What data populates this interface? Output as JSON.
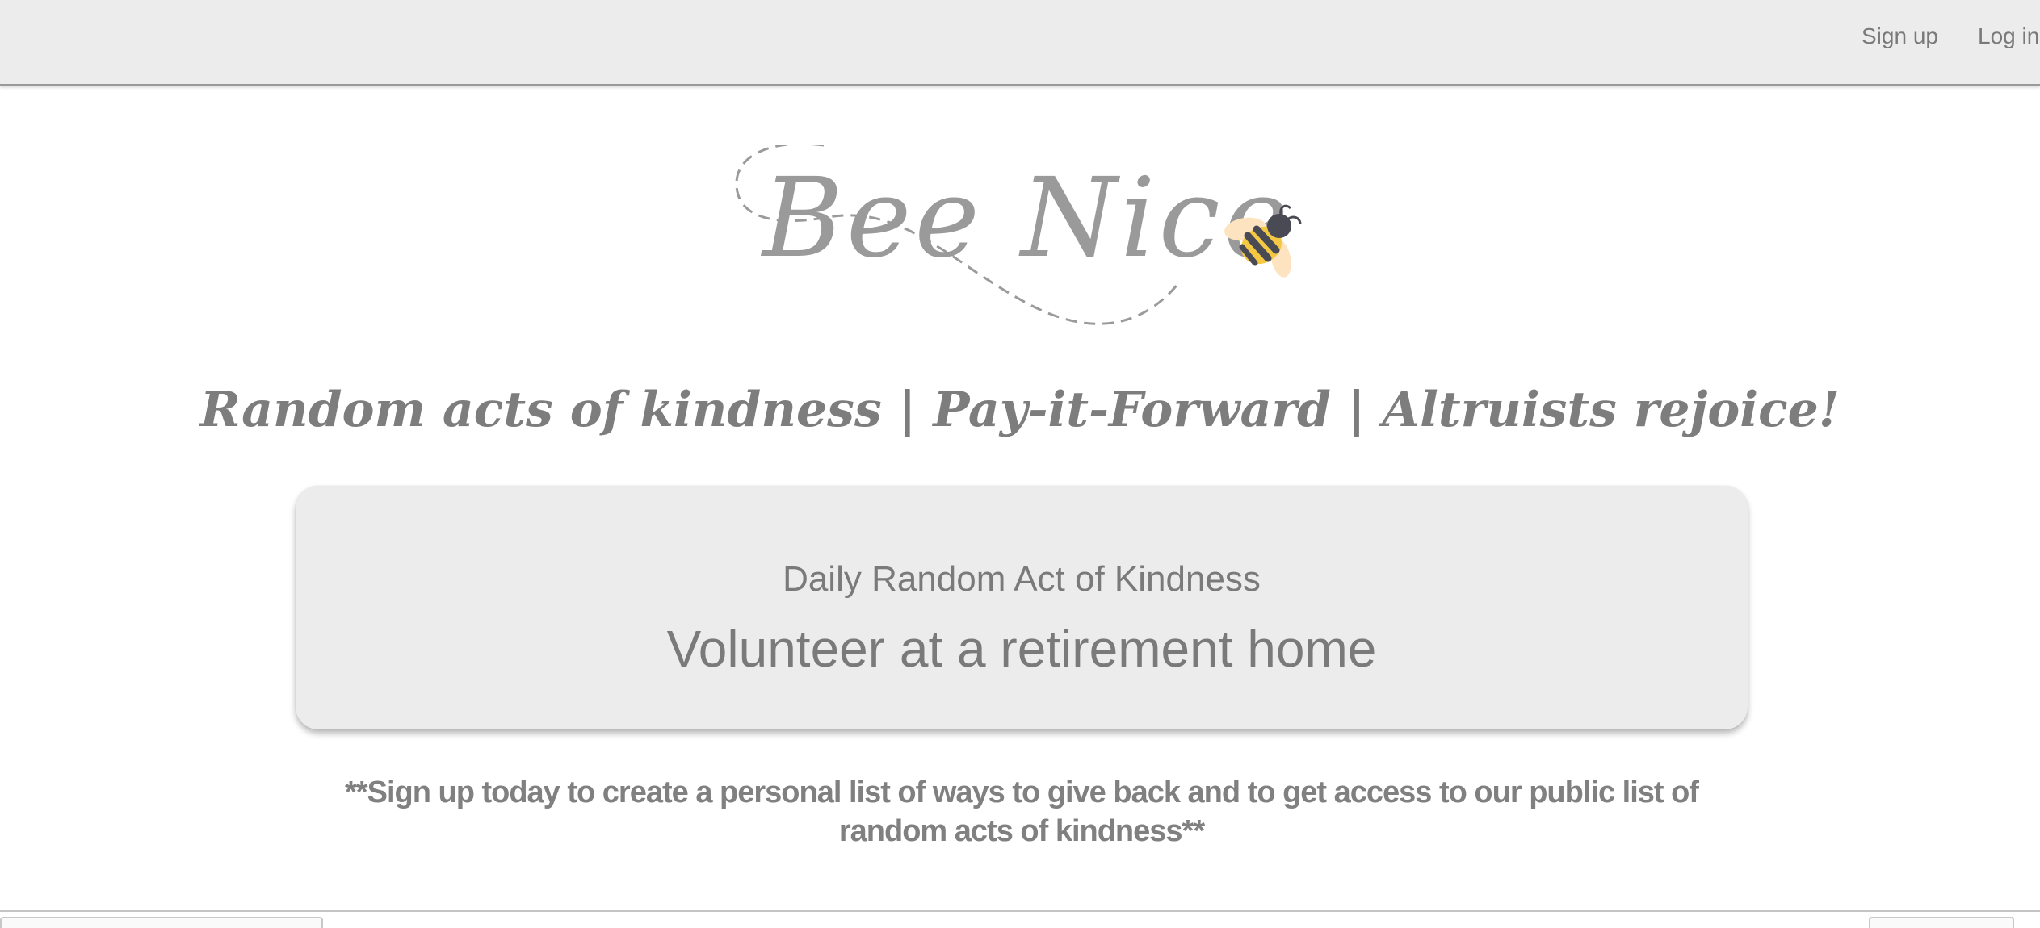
{
  "nav": {
    "signup_label": "Sign up",
    "login_label": "Log in"
  },
  "logo": {
    "text": "Bee Nice",
    "icon": "bee-icon"
  },
  "tagline": "Random acts of kindness | Pay-it-Forward | Altruists rejoice!",
  "daily_card": {
    "heading": "Daily Random Act of Kindness",
    "act": "Volunteer at a retirement home"
  },
  "signup_note": "**Sign up today to create a personal list of ways to give back and to get access to our public list of random acts of kindness**",
  "colors": {
    "navbar_bg": "#ececec",
    "card_bg": "#ececec",
    "text_gray": "#7f7f7f",
    "bee_yellow": "#f4c842",
    "bee_dark": "#4a4a55",
    "wing_peach": "#fde3c0"
  }
}
